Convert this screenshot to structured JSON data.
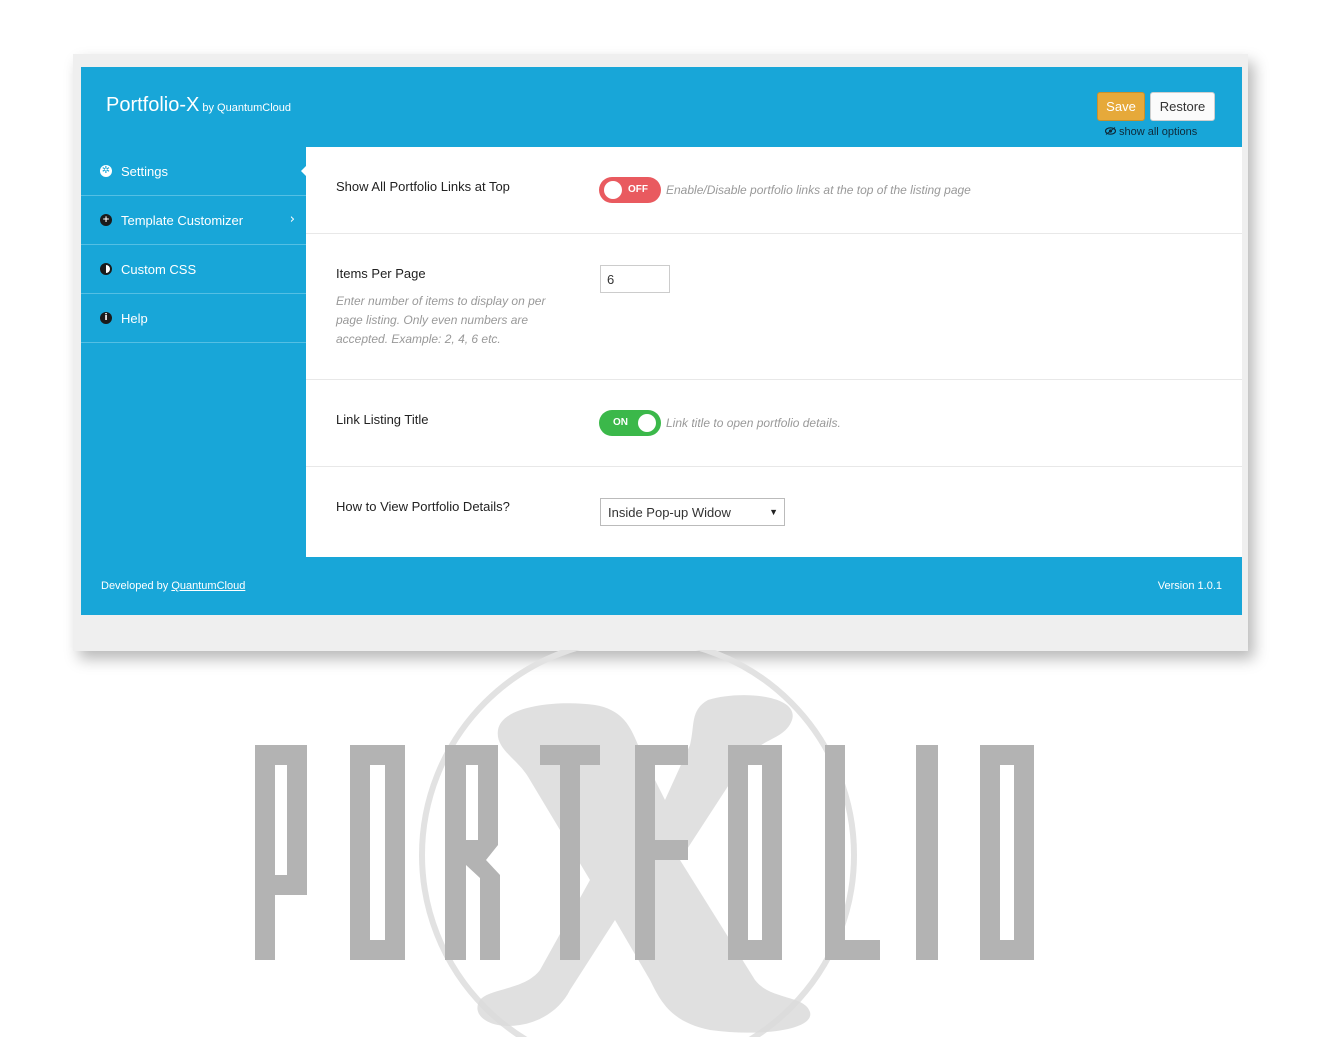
{
  "app": {
    "title": "Portfolio-X",
    "by": "by QuantumCloud"
  },
  "header": {
    "save_label": "Save",
    "restore_label": "Restore",
    "show_all_label": "show all options"
  },
  "sidebar": {
    "items": [
      {
        "label": "Settings",
        "icon": "gear-icon",
        "active": true
      },
      {
        "label": "Template Customizer",
        "icon": "plus-circle-icon",
        "active": false
      },
      {
        "label": "Custom CSS",
        "icon": "half-circle-icon",
        "active": false
      },
      {
        "label": "Help",
        "icon": "info-icon",
        "active": false
      }
    ]
  },
  "settings": {
    "show_links": {
      "label": "Show All Portfolio Links at Top",
      "state": "OFF",
      "description": "Enable/Disable portfolio links at the top of the listing page"
    },
    "items_per_page": {
      "label": "Items Per Page",
      "value": "6",
      "help": "Enter number of items to display on per page listing. Only even numbers are accepted. Example: 2, 4, 6 etc."
    },
    "link_title": {
      "label": "Link Listing Title",
      "state": "ON",
      "description": "Link title to open portfolio details."
    },
    "view_details": {
      "label": "How to View Portfolio Details?",
      "selected": "Inside Pop-up Widow"
    }
  },
  "footer": {
    "developed_by": "Developed by",
    "developer_link": "QuantumCloud",
    "version": "Version 1.0.1"
  },
  "colors": {
    "brand_blue": "#18a6d8",
    "save_orange": "#e6a93a",
    "toggle_off": "#e95a5f",
    "toggle_on": "#3bb84a"
  },
  "logo": {
    "text": "PORTFOLIO",
    "overlay": "X"
  }
}
